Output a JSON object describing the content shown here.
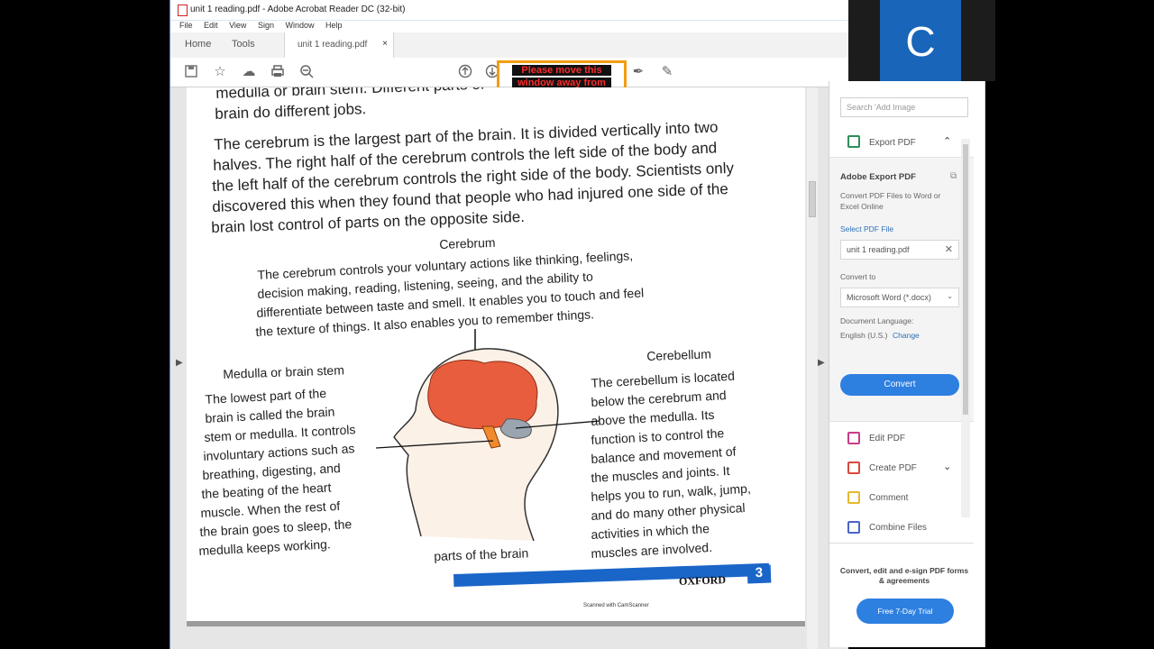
{
  "window": {
    "title": "unit 1 reading.pdf - Adobe Acrobat Reader DC (32-bit)"
  },
  "menu": [
    "File",
    "Edit",
    "View",
    "Sign",
    "Window",
    "Help"
  ],
  "tabs": {
    "home": "Home",
    "tools": "Tools",
    "doc": "unit 1 reading.pdf",
    "close": "×"
  },
  "toolbar": {
    "icons": [
      "save-icon",
      "star-icon",
      "cloud-upload-icon",
      "print-icon",
      "zoom-out-icon",
      "page-up-icon",
      "page-down-icon",
      "pen-icon",
      "sign-icon",
      "edit-icon"
    ],
    "warning_line1": "Please move this",
    "warning_line2": "window away from"
  },
  "pdf": {
    "intro_l1": "medulla or brain stem. Different parts of",
    "intro_l2": "brain do different jobs.",
    "para": [
      "The cerebrum is the largest part of the brain. It is divided vertically into two",
      "halves. The right half of the cerebrum controls the left side of the body and",
      "the left half of the cerebrum controls the right side of the body. Scientists only",
      "discovered this when they found that people who had injured one side of the",
      "brain lost control of parts on the opposite side."
    ],
    "cerebrum_title": "Cerebrum",
    "cerebrum_lines": [
      "The cerebrum controls your voluntary actions like thinking, feelings,",
      "decision making, reading, listening, seeing, and the ability to",
      "differentiate between taste and smell. It enables you to touch and feel",
      "the texture of things. It also enables you to remember things."
    ],
    "medulla_title": "Medulla or brain stem",
    "medulla_lines": [
      "The lowest part of the",
      "brain is called the brain",
      "stem or medulla. It controls",
      "involuntary actions such as",
      "breathing, digesting, and",
      "the beating of the heart",
      "muscle. When the rest of",
      "the brain goes to sleep, the",
      "medulla keeps working."
    ],
    "cerebellum_title": "Cerebellum",
    "cerebellum_lines": [
      "The cerebellum is located",
      "below the cerebrum and",
      "above the medulla. Its",
      "function is to control the",
      "balance and movement of",
      "the muscles and joints. It",
      "helps you to run, walk, jump,",
      "and do many other physical",
      "activities in which the",
      "muscles are involved."
    ],
    "diagram_caption": "parts of the brain",
    "publisher": "OXFORD",
    "page_number": "3",
    "scanned": "Scanned with CamScanner"
  },
  "right_panel": {
    "search_placeholder": "Search 'Add Image",
    "export_label": "Export PDF",
    "export_heading": "Adobe Export PDF",
    "export_desc": "Convert PDF Files to Word or Excel Online",
    "select_label": "Select PDF File",
    "file_name": "unit 1 reading.pdf",
    "convert_to_label": "Convert to",
    "convert_to_value": "Microsoft Word (*.docx)",
    "doc_lang_label": "Document Language:",
    "doc_lang_value": "English (U.S.)",
    "change_label": "Change",
    "convert_button": "Convert",
    "items": [
      {
        "label": "Edit PDF",
        "color": "#c83c8a"
      },
      {
        "label": "Create PDF",
        "color": "#d9493d"
      },
      {
        "label": "Comment",
        "color": "#e6b82d"
      },
      {
        "label": "Combine Files",
        "color": "#4a64c9"
      }
    ],
    "promo": "Convert, edit and e-sign PDF forms & agreements",
    "trial_button": "Free 7-Day Trial"
  },
  "corner_logo": "C"
}
